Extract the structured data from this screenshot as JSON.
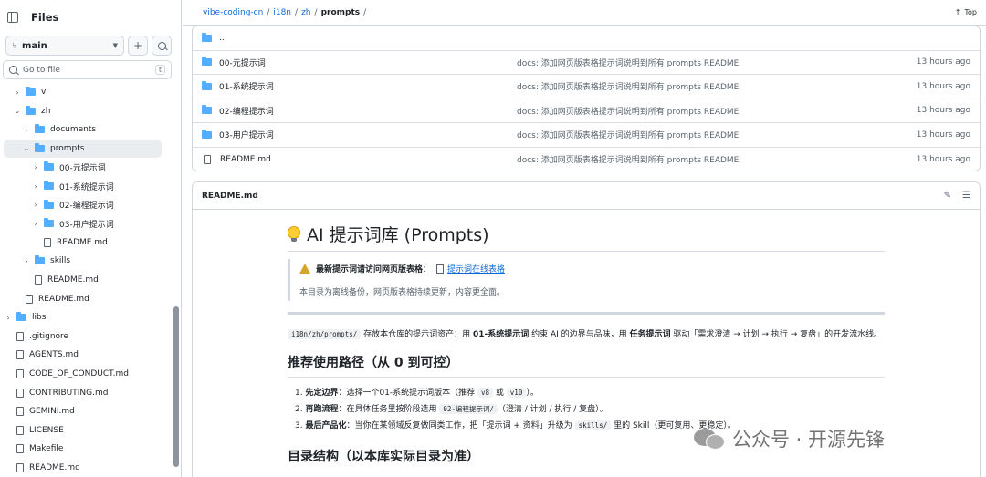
{
  "sidebar": {
    "title": "Files",
    "branch": "main",
    "goto_placeholder": "Go to file",
    "goto_kbd": "t",
    "tree": [
      {
        "label": "vi",
        "type": "folder",
        "depth": 1,
        "expanded": false
      },
      {
        "label": "zh",
        "type": "folder",
        "depth": 1,
        "expanded": true
      },
      {
        "label": "documents",
        "type": "folder",
        "depth": 2,
        "expanded": false
      },
      {
        "label": "prompts",
        "type": "folder",
        "depth": 2,
        "expanded": true,
        "selected": true
      },
      {
        "label": "00-元提示词",
        "type": "folder",
        "depth": 3,
        "expanded": false
      },
      {
        "label": "01-系统提示词",
        "type": "folder",
        "depth": 3,
        "expanded": false
      },
      {
        "label": "02-编程提示词",
        "type": "folder",
        "depth": 3,
        "expanded": false
      },
      {
        "label": "03-用户提示词",
        "type": "folder",
        "depth": 3,
        "expanded": false
      },
      {
        "label": "README.md",
        "type": "file",
        "depth": 3
      },
      {
        "label": "skills",
        "type": "folder",
        "depth": 2,
        "expanded": false
      },
      {
        "label": "README.md",
        "type": "file",
        "depth": 2
      },
      {
        "label": "README.md",
        "type": "file",
        "depth": 1
      },
      {
        "label": "libs",
        "type": "folder",
        "depth": 0,
        "expanded": false
      },
      {
        "label": ".gitignore",
        "type": "file",
        "depth": 0
      },
      {
        "label": "AGENTS.md",
        "type": "file",
        "depth": 0
      },
      {
        "label": "CODE_OF_CONDUCT.md",
        "type": "file",
        "depth": 0
      },
      {
        "label": "CONTRIBUTING.md",
        "type": "file",
        "depth": 0
      },
      {
        "label": "GEMINI.md",
        "type": "file",
        "depth": 0
      },
      {
        "label": "LICENSE",
        "type": "file",
        "depth": 0
      },
      {
        "label": "Makefile",
        "type": "file",
        "depth": 0
      },
      {
        "label": "README.md",
        "type": "file",
        "depth": 0
      }
    ]
  },
  "breadcrumb": {
    "repo": "vibe-coding-cn",
    "p1": "i18n",
    "p2": "zh",
    "current": "prompts",
    "top_label": "Top"
  },
  "listing": [
    {
      "name": "..",
      "type": "folder",
      "message": "",
      "time": ""
    },
    {
      "name": "00-元提示词",
      "type": "folder",
      "message": "docs: 添加网页版表格提示词说明到所有 prompts README",
      "time": "13 hours ago"
    },
    {
      "name": "01-系统提示词",
      "type": "folder",
      "message": "docs: 添加网页版表格提示词说明到所有 prompts README",
      "time": "13 hours ago"
    },
    {
      "name": "02-编程提示词",
      "type": "folder",
      "message": "docs: 添加网页版表格提示词说明到所有 prompts README",
      "time": "13 hours ago"
    },
    {
      "name": "03-用户提示词",
      "type": "folder",
      "message": "docs: 添加网页版表格提示词说明到所有 prompts README",
      "time": "13 hours ago"
    },
    {
      "name": "README.md",
      "type": "file",
      "message": "docs: 添加网页版表格提示词说明到所有 prompts README",
      "time": "13 hours ago"
    }
  ],
  "readme": {
    "filename": "README.md",
    "title": "AI 提示词库 (Prompts)",
    "alert_strong": "最新提示词请访问网页版表格：",
    "alert_link": "提示词在线表格",
    "alert_note": "本目录为离线备份，网页版表格持续更新，内容更全面。",
    "intro_code": "i18n/zh/prompts/",
    "intro_a": " 存放本仓库的提示词资产：用 ",
    "intro_b1": "01-系统提示词",
    "intro_c": " 约束 AI 的边界与品味，用 ",
    "intro_b2": "任务提示词",
    "intro_d": " 驱动「需求澄清 → 计划 → 执行 → 复盘」的开发流水线。",
    "h2": "推荐使用路径（从 0 到可控）",
    "steps": [
      {
        "strong": "先定边界",
        "a": "：选择一个01-系统提示词版本（推荐 ",
        "code1": "v8",
        "b": " 或 ",
        "code2": "v10",
        "c": "）。"
      },
      {
        "strong": "再跑流程",
        "a": "：在具体任务里按阶段选用 ",
        "code1": "02-编程提示词/",
        "b": "（澄清 / 计划 / 执行 / 复盘）。",
        "code2": "",
        "c": ""
      },
      {
        "strong": "最后产品化",
        "a": "：当你在某领域反复做同类工作，把「提示词 + 资料」升级为 ",
        "code1": "skills/",
        "b": " 里的 Skill（更可复用、更稳定）。",
        "code2": "",
        "c": ""
      }
    ],
    "h2_next": "目录结构（以本库实际目录为准）"
  },
  "watermark": "公众号 · 开源先锋"
}
